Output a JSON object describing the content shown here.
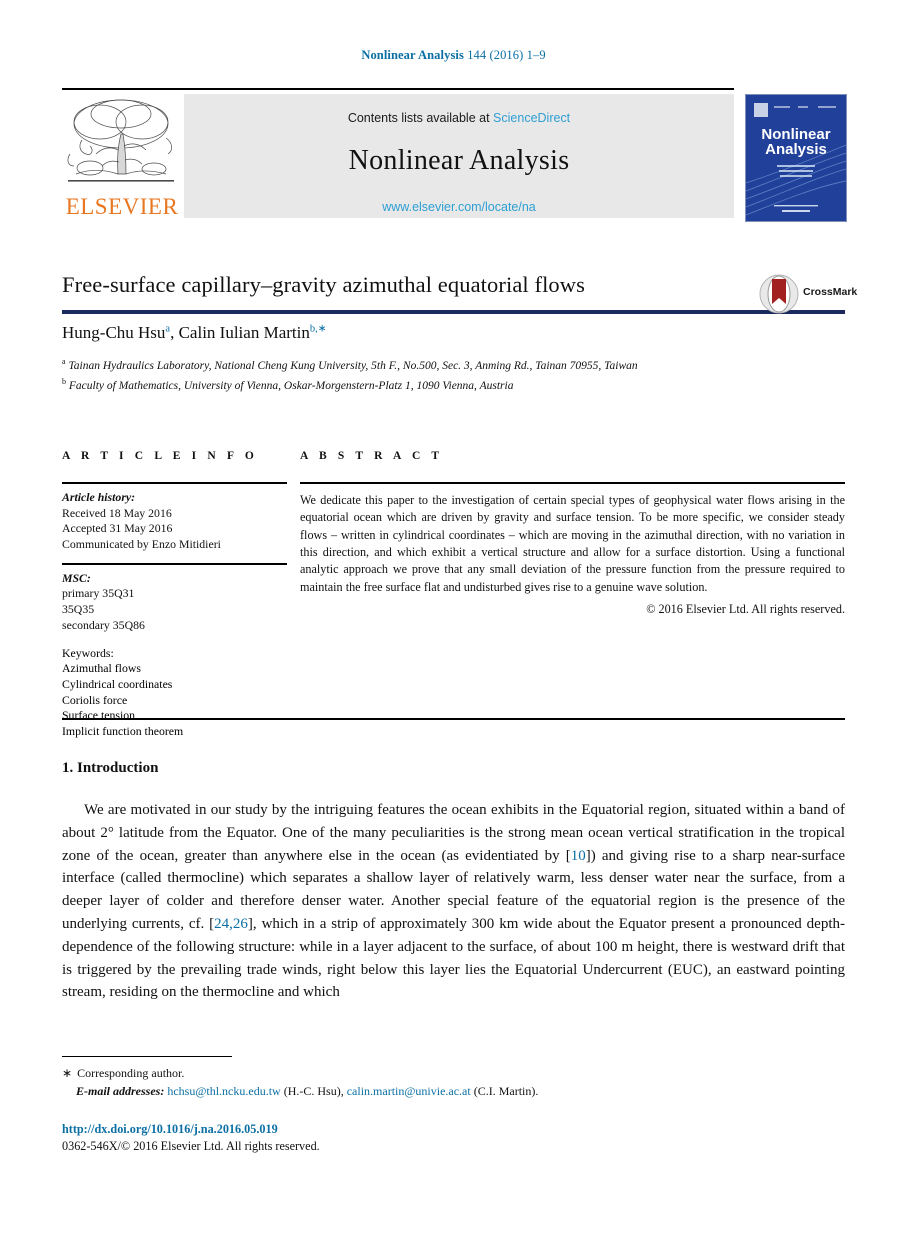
{
  "running_head": {
    "journal": "Nonlinear Analysis",
    "citation": "144 (2016) 1–9"
  },
  "banner": {
    "contents_prefix": "Contents lists available at",
    "sciencedirect": "ScienceDirect",
    "journal_title": "Nonlinear Analysis",
    "journal_url": "www.elsevier.com/locate/na",
    "publisher_wordmark": "ELSEVIER",
    "cover_title_line1": "Nonlinear",
    "cover_title_line2": "Analysis"
  },
  "article": {
    "title": "Free-surface capillary–gravity azimuthal equatorial flows",
    "crossmark_label": "CrossMark",
    "authors_html": "Hung-Chu Hsu<sup>a</sup>, Calin Iulian Martin<sup>b,∗</sup>",
    "affiliation_a": "Tainan Hydraulics Laboratory, National Cheng Kung University, 5th F., No.500, Sec. 3, Anming Rd., Tainan 70955, Taiwan",
    "affiliation_b": "Faculty of Mathematics, University of Vienna, Oskar-Morgenstern-Platz 1, 1090 Vienna, Austria",
    "affiliation_a_marker": "a",
    "affiliation_b_marker": "b"
  },
  "article_info": {
    "heading": "A R T I C L E    I N F O",
    "history_label": "Article history:",
    "history": [
      "Received 18 May 2016",
      "Accepted 31 May 2016",
      "Communicated by Enzo Mitidieri"
    ],
    "msc_label": "MSC:",
    "msc": [
      "primary 35Q31",
      "35Q35",
      "secondary 35Q86"
    ],
    "keywords_label": "Keywords:",
    "keywords": [
      "Azimuthal flows",
      "Cylindrical coordinates",
      "Coriolis force",
      "Surface tension",
      "Implicit function theorem"
    ]
  },
  "abstract": {
    "heading": "A B S T R A C T",
    "text": "We dedicate this paper to the investigation of certain special types of geophysical water flows arising in the equatorial ocean which are driven by gravity and surface tension. To be more specific, we consider steady flows – written in cylindrical coordinates – which are moving in the azimuthal direction, with no variation in this direction, and which exhibit a vertical structure and allow for a surface distortion. Using a functional analytic approach we prove that any small deviation of the pressure function from the pressure required to maintain the free surface flat and undisturbed gives rise to a genuine wave solution.",
    "copyright": "© 2016 Elsevier Ltd. All rights reserved."
  },
  "body": {
    "section_heading": "1.  Introduction",
    "paragraph_parts": {
      "p1": "We are motivated in our study by the intriguing features the ocean exhibits in the Equatorial region, situated within a band of about 2° latitude from the Equator. One of the many peculiarities is the strong mean ocean vertical stratification in the tropical zone of the ocean, greater than anywhere else in the ocean (as evidentiated by [",
      "ref1": "10",
      "p2": "]) and giving rise to a sharp near-surface interface (called thermocline) which separates a shallow layer of relatively warm, less denser water near the surface, from a deeper layer of colder and therefore denser water. Another special feature of the equatorial region is the presence of the underlying currents, cf. [",
      "ref2": "24,26",
      "p3": "], which in a strip of approximately 300 km wide about the Equator present a pronounced depth-dependence of the following structure: while in a layer adjacent to the surface, of about 100 m height, there is westward drift that is triggered by the prevailing trade winds, right below this layer lies the Equatorial Undercurrent (EUC), an eastward pointing stream, residing on the thermocline and which"
    }
  },
  "footer": {
    "corresponding_marker": "∗",
    "corresponding_text": "Corresponding author.",
    "email_label": "E-mail addresses:",
    "email_1": "hchsu@thl.ncku.edu.tw",
    "email_1_owner": "(H.-C. Hsu),",
    "email_2": "calin.martin@univie.ac.at",
    "email_2_owner": "(C.I. Martin).",
    "doi": "http://dx.doi.org/10.1016/j.na.2016.05.019",
    "issn_copyright": "0362-546X/© 2016 Elsevier Ltd. All rights reserved."
  },
  "colors": {
    "link": "#0b6fa4",
    "sciencedirect": "#2e9fd4",
    "elsevier_orange": "#e87722",
    "cover_blue": "#1f3f8f",
    "rule_navy": "#1b2a5e"
  }
}
